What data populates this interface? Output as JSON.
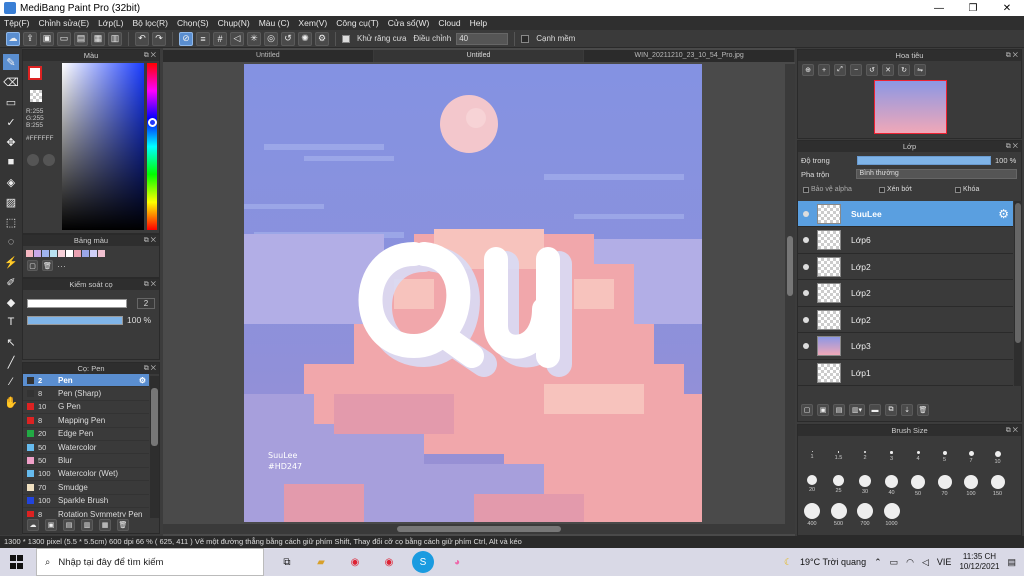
{
  "titlebar": {
    "title": "MediBang Paint Pro (32bit)",
    "minimize": "—",
    "maximize": "❐",
    "close": "✕"
  },
  "menu": [
    "Tệp(F)",
    "Chỉnh sửa(E)",
    "Lớp(L)",
    "Bộ lọc(R)",
    "Chọn(S)",
    "Chụp(N)",
    "Màu (C)",
    "Xem(V)",
    "Công cụ(T)",
    "Cửa sổ(W)",
    "Cloud",
    "Help"
  ],
  "toolbar": {
    "antialias_label": "Khử răng cưa",
    "adjust_label": "Điều chỉnh",
    "adjust_value": "40",
    "snap_label": "Cạnh mềm"
  },
  "tabs": [
    "Untitled",
    "Untitled",
    "WIN_20211210_23_10_54_Pro.jpg"
  ],
  "color_panel": {
    "title": "Màu",
    "r": "R:255",
    "g": "G:255",
    "b": "B:255",
    "hex": "#FFFFFF",
    "fg": "#ffffff",
    "accent": "#d22222"
  },
  "palette_panel": {
    "title": "Bảng màu",
    "swatches": [
      "#f4b6c0",
      "#c7a8e8",
      "#a0b4f0",
      "#b8e0f0",
      "#f6d0d8",
      "#ffffff",
      "#e8a0b0",
      "#9aa6e8",
      "#d0d0f8",
      "#f0c0d0"
    ],
    "more": "···"
  },
  "control_panel": {
    "title": "Kiểm soát cọ",
    "size_value": "2",
    "opacity_value": "100 %"
  },
  "brush_panel": {
    "title": "Cọ: Pen",
    "items": [
      {
        "num": "2",
        "name": "Pen",
        "color": "#333333"
      },
      {
        "num": "8",
        "name": "Pen (Sharp)",
        "color": "#333333"
      },
      {
        "num": "10",
        "name": "G Pen",
        "color": "#dd2222"
      },
      {
        "num": "8",
        "name": "Mapping Pen",
        "color": "#dd2222"
      },
      {
        "num": "20",
        "name": "Edge Pen",
        "color": "#22aa44"
      },
      {
        "num": "50",
        "name": "Watercolor",
        "color": "#66bbee"
      },
      {
        "num": "50",
        "name": "Blur",
        "color": "#f0a0c8"
      },
      {
        "num": "100",
        "name": "Watercolor (Wet)",
        "color": "#66bbee"
      },
      {
        "num": "70",
        "name": "Smudge",
        "color": "#f0e0c0"
      },
      {
        "num": "100",
        "name": "Sparkle Brush",
        "color": "#2244dd"
      },
      {
        "num": "8",
        "name": "Rotation Symmetry Pen",
        "color": "#dd2222"
      }
    ]
  },
  "artwork": {
    "signature_name": "SuuLee",
    "signature_tag": "#HD247",
    "lettering": "Qu"
  },
  "nav_panel": {
    "title": "Hoa tiêu"
  },
  "layer_panel": {
    "title": "Lớp",
    "opacity_label": "Độ trong",
    "opacity_value": "100 %",
    "blend_label": "Pha trộn",
    "blend_value": "Bình thường",
    "protect_alpha": "Bảo vệ alpha",
    "clipping": "Xén bớt",
    "lock": "Khóa",
    "layers": [
      "SuuLee",
      "Lớp6",
      "Lớp2",
      "Lớp2",
      "Lớp2",
      "Lớp3",
      "Lớp1"
    ]
  },
  "brush_size_panel": {
    "title": "Brush Size",
    "sizes": [
      "1",
      "1.5",
      "2",
      "3",
      "4",
      "5",
      "7",
      "10",
      "20",
      "25",
      "30",
      "40",
      "50",
      "70",
      "100",
      "150",
      "400",
      "500",
      "700",
      "1000"
    ]
  },
  "status": {
    "text": "1300 * 1300 pixel  (5.5 * 5.5cm)  600 dpi  66 %  ( 625, 411 )  Vẽ một đường thẳng bằng cách giữ phím Shift, Thay đổi cỡ cọ bằng cách giữ phím Ctrl, Alt và kéo"
  },
  "taskbar": {
    "search_placeholder": "Nhập tại đây để tìm kiếm",
    "weather": "19°C  Trời quang",
    "lang": "VIE",
    "time": "11:35 CH",
    "date": "10/12/2021"
  }
}
